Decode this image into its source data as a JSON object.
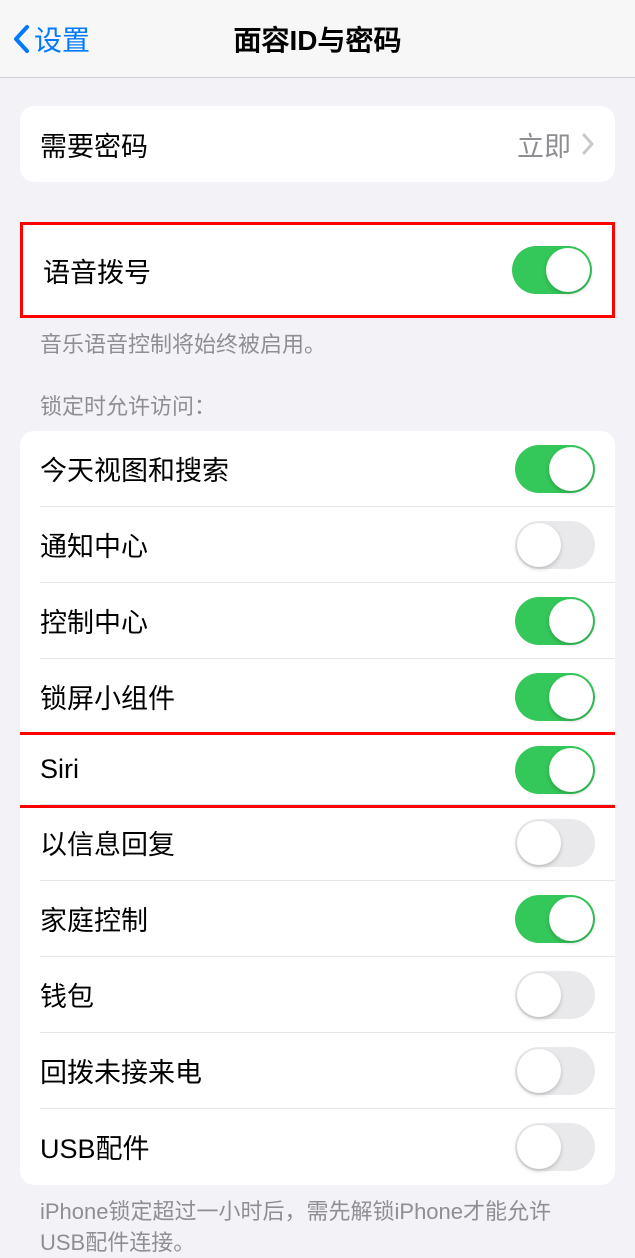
{
  "nav": {
    "back_label": "设置",
    "title": "面容ID与密码"
  },
  "require_passcode": {
    "label": "需要密码",
    "value": "立即"
  },
  "voice_dial": {
    "label": "语音拨号",
    "on": true,
    "footer": "音乐语音控制将始终被启用。"
  },
  "lock_access": {
    "header": "锁定时允许访问：",
    "items": [
      {
        "label": "今天视图和搜索",
        "on": true
      },
      {
        "label": "通知中心",
        "on": false
      },
      {
        "label": "控制中心",
        "on": true
      },
      {
        "label": "锁屏小组件",
        "on": true
      },
      {
        "label": "Siri",
        "on": true
      },
      {
        "label": "以信息回复",
        "on": false
      },
      {
        "label": "家庭控制",
        "on": true
      },
      {
        "label": "钱包",
        "on": false
      },
      {
        "label": "回拨未接来电",
        "on": false
      },
      {
        "label": "USB配件",
        "on": false
      }
    ],
    "footer": "iPhone锁定超过一小时后，需先解锁iPhone才能允许USB配件连接。"
  }
}
